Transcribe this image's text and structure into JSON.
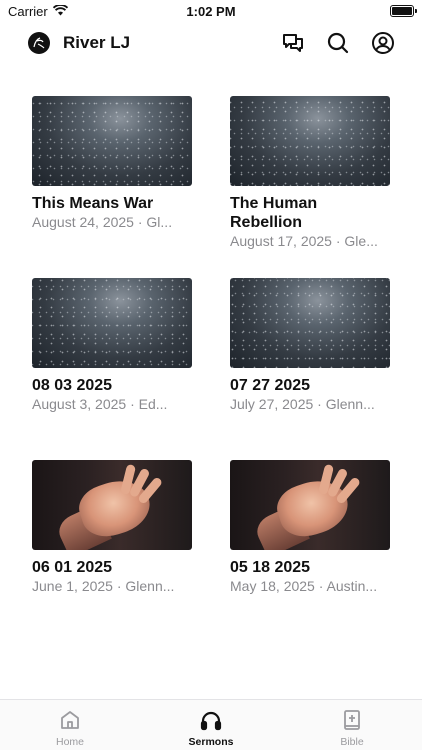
{
  "status_bar": {
    "carrier": "Carrier",
    "time": "1:02 PM"
  },
  "header": {
    "title": "River LJ"
  },
  "sermons": [
    {
      "title": "This Means War",
      "subtitle": "August 24, 2025 · Gl...",
      "thumb": "stars"
    },
    {
      "title": "The Human Rebellion",
      "subtitle": "August 17, 2025 · Gle...",
      "thumb": "stars"
    },
    {
      "title": "08 03 2025",
      "subtitle": "August 3, 2025 · Ed...",
      "thumb": "stars"
    },
    {
      "title": "07 27 2025",
      "subtitle": "July 27, 2025 · Glenn...",
      "thumb": "stars"
    },
    {
      "title": "06 01 2025",
      "subtitle": "June 1, 2025 · Glenn...",
      "thumb": "hand"
    },
    {
      "title": "05 18 2025",
      "subtitle": "May 18, 2025 · Austin...",
      "thumb": "hand"
    }
  ],
  "tabs": [
    {
      "label": "Home",
      "icon": "home-icon",
      "active": false
    },
    {
      "label": "Sermons",
      "icon": "headphones-icon",
      "active": true
    },
    {
      "label": "Bible",
      "icon": "bible-icon",
      "active": false
    }
  ]
}
